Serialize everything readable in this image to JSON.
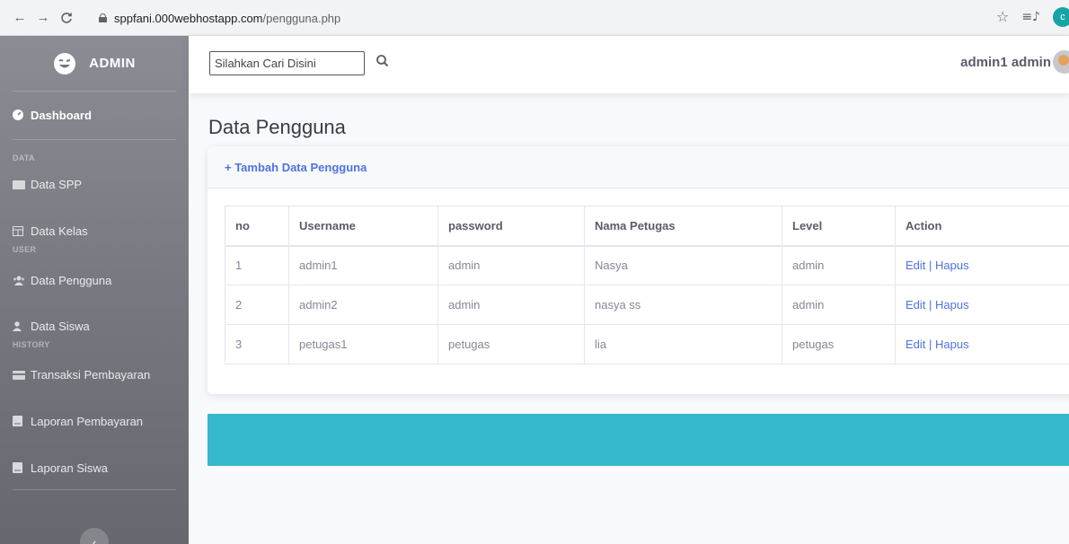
{
  "browser": {
    "url_host": "sppfani.000webhostapp.com",
    "url_path": "/pengguna.php",
    "profile_initial": "c"
  },
  "sidebar": {
    "brand": "ADMIN",
    "dashboard": "Dashboard",
    "heading_data": "DATA",
    "data_spp": "Data SPP",
    "data_kelas": "Data Kelas",
    "heading_user": "USER",
    "data_pengguna": "Data Pengguna",
    "data_siswa": "Data Siswa",
    "heading_history": "HISTORY",
    "transaksi": "Transaksi Pembayaran",
    "laporan_pembayaran": "Laporan Pembayaran",
    "laporan_siswa": "Laporan Siswa"
  },
  "topbar": {
    "search_placeholder": "Silahkan Cari Disini",
    "user_name": "admin1 admin"
  },
  "page": {
    "title": "Data Pengguna",
    "add_button": "+ Tambah Data Pengguna"
  },
  "table": {
    "headers": {
      "no": "no",
      "username": "Username",
      "password": "password",
      "nama_petugas": "Nama Petugas",
      "level": "Level",
      "action": "Action"
    },
    "rows": [
      {
        "no": "1",
        "username": "admin1",
        "password": "admin",
        "nama_petugas": "Nasya",
        "level": "admin",
        "edit": "Edit",
        "sep": "|",
        "hapus": "Hapus"
      },
      {
        "no": "2",
        "username": "admin2",
        "password": "admin",
        "nama_petugas": "nasya ss",
        "level": "admin",
        "edit": "Edit",
        "sep": "|",
        "hapus": "Hapus"
      },
      {
        "no": "3",
        "username": "petugas1",
        "password": "petugas",
        "nama_petugas": "lia",
        "level": "petugas",
        "edit": "Edit",
        "sep": "|",
        "hapus": "Hapus"
      }
    ]
  },
  "colors": {
    "primary": "#4e73df",
    "info": "#36b9cc",
    "sidebar_gray": "#74777e"
  }
}
